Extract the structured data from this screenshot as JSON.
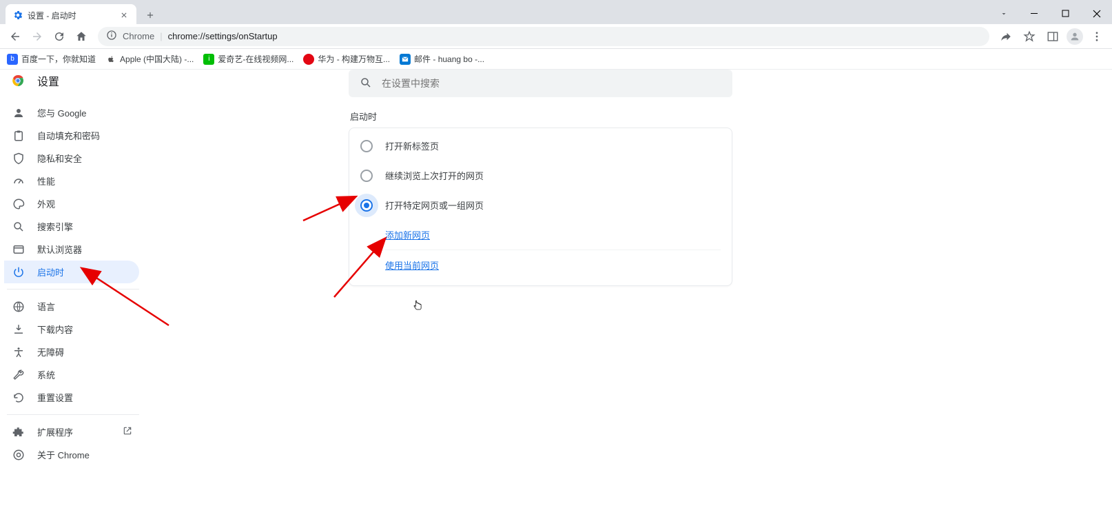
{
  "window": {
    "tab_title": "设置 - 启动时"
  },
  "toolbar": {
    "chrome_label": "Chrome",
    "url": "chrome://settings/onStartup"
  },
  "bookmarks": [
    {
      "label": "百度一下，你就知道",
      "color": "#2a66ff"
    },
    {
      "label": "Apple (中国大陆) -...",
      "color": "#8e8e8e"
    },
    {
      "label": "爱奇艺-在线视频网...",
      "color": "#00be06"
    },
    {
      "label": "华为 - 构建万物互...",
      "color": "#e30613"
    },
    {
      "label": "邮件 - huang bo -...",
      "color": "#0078d4"
    }
  ],
  "settings": {
    "title": "设置",
    "search_placeholder": "在设置中搜索"
  },
  "sidebar": [
    {
      "key": "you",
      "label": "您与 Google"
    },
    {
      "key": "autofill",
      "label": "自动填充和密码"
    },
    {
      "key": "privacy",
      "label": "隐私和安全"
    },
    {
      "key": "performance",
      "label": "性能"
    },
    {
      "key": "appearance",
      "label": "外观"
    },
    {
      "key": "search",
      "label": "搜索引擎"
    },
    {
      "key": "default",
      "label": "默认浏览器"
    },
    {
      "key": "startup",
      "label": "启动时"
    },
    {
      "key": "language",
      "label": "语言"
    },
    {
      "key": "downloads",
      "label": "下载内容"
    },
    {
      "key": "accessibility",
      "label": "无障碍"
    },
    {
      "key": "system",
      "label": "系统"
    },
    {
      "key": "reset",
      "label": "重置设置"
    },
    {
      "key": "extensions",
      "label": "扩展程序"
    },
    {
      "key": "about",
      "label": "关于 Chrome"
    }
  ],
  "content": {
    "section_title": "启动时",
    "options": [
      {
        "label": "打开新标签页"
      },
      {
        "label": "继续浏览上次打开的网页"
      },
      {
        "label": "打开特定网页或一组网页"
      }
    ],
    "links": {
      "add_page": "添加新网页",
      "use_current": "使用当前网页"
    }
  }
}
